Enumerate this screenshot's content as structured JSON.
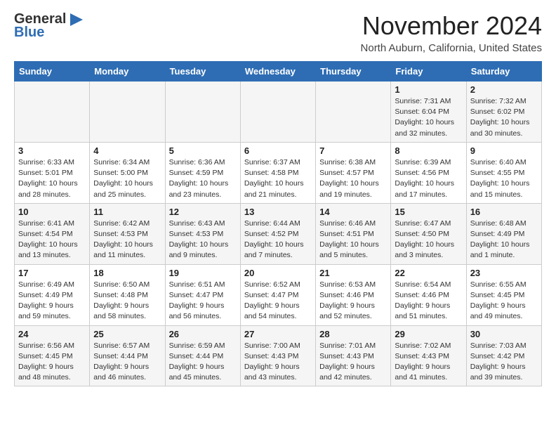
{
  "header": {
    "logo_general": "General",
    "logo_blue": "Blue",
    "month_title": "November 2024",
    "location": "North Auburn, California, United States"
  },
  "days_of_week": [
    "Sunday",
    "Monday",
    "Tuesday",
    "Wednesday",
    "Thursday",
    "Friday",
    "Saturday"
  ],
  "weeks": [
    [
      {
        "day": "",
        "info": ""
      },
      {
        "day": "",
        "info": ""
      },
      {
        "day": "",
        "info": ""
      },
      {
        "day": "",
        "info": ""
      },
      {
        "day": "",
        "info": ""
      },
      {
        "day": "1",
        "info": "Sunrise: 7:31 AM\nSunset: 6:04 PM\nDaylight: 10 hours and 32 minutes."
      },
      {
        "day": "2",
        "info": "Sunrise: 7:32 AM\nSunset: 6:02 PM\nDaylight: 10 hours and 30 minutes."
      }
    ],
    [
      {
        "day": "3",
        "info": "Sunrise: 6:33 AM\nSunset: 5:01 PM\nDaylight: 10 hours and 28 minutes."
      },
      {
        "day": "4",
        "info": "Sunrise: 6:34 AM\nSunset: 5:00 PM\nDaylight: 10 hours and 25 minutes."
      },
      {
        "day": "5",
        "info": "Sunrise: 6:36 AM\nSunset: 4:59 PM\nDaylight: 10 hours and 23 minutes."
      },
      {
        "day": "6",
        "info": "Sunrise: 6:37 AM\nSunset: 4:58 PM\nDaylight: 10 hours and 21 minutes."
      },
      {
        "day": "7",
        "info": "Sunrise: 6:38 AM\nSunset: 4:57 PM\nDaylight: 10 hours and 19 minutes."
      },
      {
        "day": "8",
        "info": "Sunrise: 6:39 AM\nSunset: 4:56 PM\nDaylight: 10 hours and 17 minutes."
      },
      {
        "day": "9",
        "info": "Sunrise: 6:40 AM\nSunset: 4:55 PM\nDaylight: 10 hours and 15 minutes."
      }
    ],
    [
      {
        "day": "10",
        "info": "Sunrise: 6:41 AM\nSunset: 4:54 PM\nDaylight: 10 hours and 13 minutes."
      },
      {
        "day": "11",
        "info": "Sunrise: 6:42 AM\nSunset: 4:53 PM\nDaylight: 10 hours and 11 minutes."
      },
      {
        "day": "12",
        "info": "Sunrise: 6:43 AM\nSunset: 4:53 PM\nDaylight: 10 hours and 9 minutes."
      },
      {
        "day": "13",
        "info": "Sunrise: 6:44 AM\nSunset: 4:52 PM\nDaylight: 10 hours and 7 minutes."
      },
      {
        "day": "14",
        "info": "Sunrise: 6:46 AM\nSunset: 4:51 PM\nDaylight: 10 hours and 5 minutes."
      },
      {
        "day": "15",
        "info": "Sunrise: 6:47 AM\nSunset: 4:50 PM\nDaylight: 10 hours and 3 minutes."
      },
      {
        "day": "16",
        "info": "Sunrise: 6:48 AM\nSunset: 4:49 PM\nDaylight: 10 hours and 1 minute."
      }
    ],
    [
      {
        "day": "17",
        "info": "Sunrise: 6:49 AM\nSunset: 4:49 PM\nDaylight: 9 hours and 59 minutes."
      },
      {
        "day": "18",
        "info": "Sunrise: 6:50 AM\nSunset: 4:48 PM\nDaylight: 9 hours and 58 minutes."
      },
      {
        "day": "19",
        "info": "Sunrise: 6:51 AM\nSunset: 4:47 PM\nDaylight: 9 hours and 56 minutes."
      },
      {
        "day": "20",
        "info": "Sunrise: 6:52 AM\nSunset: 4:47 PM\nDaylight: 9 hours and 54 minutes."
      },
      {
        "day": "21",
        "info": "Sunrise: 6:53 AM\nSunset: 4:46 PM\nDaylight: 9 hours and 52 minutes."
      },
      {
        "day": "22",
        "info": "Sunrise: 6:54 AM\nSunset: 4:46 PM\nDaylight: 9 hours and 51 minutes."
      },
      {
        "day": "23",
        "info": "Sunrise: 6:55 AM\nSunset: 4:45 PM\nDaylight: 9 hours and 49 minutes."
      }
    ],
    [
      {
        "day": "24",
        "info": "Sunrise: 6:56 AM\nSunset: 4:45 PM\nDaylight: 9 hours and 48 minutes."
      },
      {
        "day": "25",
        "info": "Sunrise: 6:57 AM\nSunset: 4:44 PM\nDaylight: 9 hours and 46 minutes."
      },
      {
        "day": "26",
        "info": "Sunrise: 6:59 AM\nSunset: 4:44 PM\nDaylight: 9 hours and 45 minutes."
      },
      {
        "day": "27",
        "info": "Sunrise: 7:00 AM\nSunset: 4:43 PM\nDaylight: 9 hours and 43 minutes."
      },
      {
        "day": "28",
        "info": "Sunrise: 7:01 AM\nSunset: 4:43 PM\nDaylight: 9 hours and 42 minutes."
      },
      {
        "day": "29",
        "info": "Sunrise: 7:02 AM\nSunset: 4:43 PM\nDaylight: 9 hours and 41 minutes."
      },
      {
        "day": "30",
        "info": "Sunrise: 7:03 AM\nSunset: 4:42 PM\nDaylight: 9 hours and 39 minutes."
      }
    ]
  ]
}
